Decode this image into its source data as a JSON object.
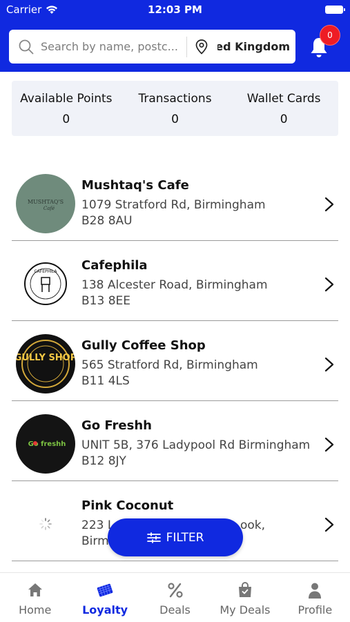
{
  "status_bar": {
    "carrier": "Carrier",
    "time": "12:03 PM"
  },
  "header": {
    "search_placeholder": "Search by name, postc...",
    "location": "ted Kingdom",
    "notification_count": "0"
  },
  "stats": [
    {
      "label": "Available Points",
      "value": "0"
    },
    {
      "label": "Transactions",
      "value": "0"
    },
    {
      "label": "Wallet Cards",
      "value": "0"
    }
  ],
  "merchants": [
    {
      "name": "Mushtaq's Cafe",
      "address_line1": "1079 Stratford Rd, Birmingham",
      "address_line2": "B28 8AU",
      "logo_text": "MUSHTAQ'S"
    },
    {
      "name": "Cafephila",
      "address_line1": "138 Alcester Road, Birmingham",
      "address_line2": "B13 8EE",
      "logo_text": "CAFEPHILA"
    },
    {
      "name": "Gully Coffee Shop",
      "address_line1": "565 Stratford Rd, Birmingham",
      "address_line2": "B11 4LS",
      "logo_text": "GULLY SHOP"
    },
    {
      "name": "Go Freshh",
      "address_line1": "UNIT 5B, 376 Ladypool Rd Birmingham",
      "address_line2": "B12 8JY",
      "logo_text": "Go freshh"
    },
    {
      "name": "Pink Coconut",
      "address_line1": "223 L",
      "address_line1_tail": "ook,",
      "address_line2": "Birm"
    }
  ],
  "filter_button": {
    "label": "FILTER"
  },
  "tabs": [
    {
      "label": "Home",
      "icon": "home-icon"
    },
    {
      "label": "Loyalty",
      "icon": "loyalty-card-icon",
      "active": true
    },
    {
      "label": "Deals",
      "icon": "percent-icon"
    },
    {
      "label": "My Deals",
      "icon": "shopping-bag-icon"
    },
    {
      "label": "Profile",
      "icon": "person-icon"
    }
  ],
  "colors": {
    "primary": "#1029e0",
    "badge": "#ee1c25",
    "stats_bg": "#f0f2f8"
  }
}
